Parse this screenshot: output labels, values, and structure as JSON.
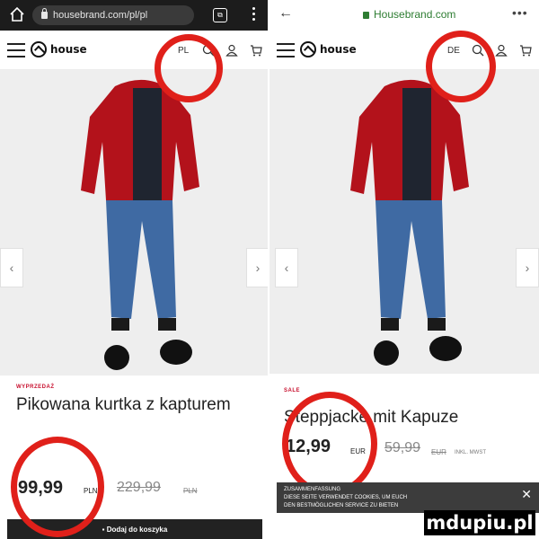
{
  "left": {
    "browser": {
      "url": "housebrand.com/pl/pl",
      "tabs_count": "⧉"
    },
    "header": {
      "lang": "PL"
    },
    "product": {
      "badge": "WYPRZEDAŻ",
      "title": "Pikowana kurtka z kapturem",
      "price_now": "99,99",
      "currency_now": "PLN",
      "price_old": "229,99",
      "currency_old": "PLN",
      "cta": "Dodaj do koszyka"
    }
  },
  "right": {
    "browser": {
      "domain": "Housebrand.com"
    },
    "header": {
      "lang": "DE"
    },
    "product": {
      "badge": "SALE",
      "title": "Steppjacke mit Kapuze",
      "price_now": "12,99",
      "currency_now": "EUR",
      "price_old": "59,99",
      "currency_old": "EUR",
      "vat": "INKL. MWST"
    },
    "cookie": {
      "line1": "ZUSAMMENFASSUNG",
      "line2": "DIESE SEITE VERWENDET COOKIES, UM EUCH",
      "line3": "DEN BESTMÖGLICHEN SERVICE ZU BIETEN"
    }
  },
  "watermark": "mdupiu.pl",
  "colors": {
    "ring": "#e0201a",
    "badge": "#c8102e",
    "jacket": "#b3121b",
    "jeans": "#3f6aa3"
  }
}
